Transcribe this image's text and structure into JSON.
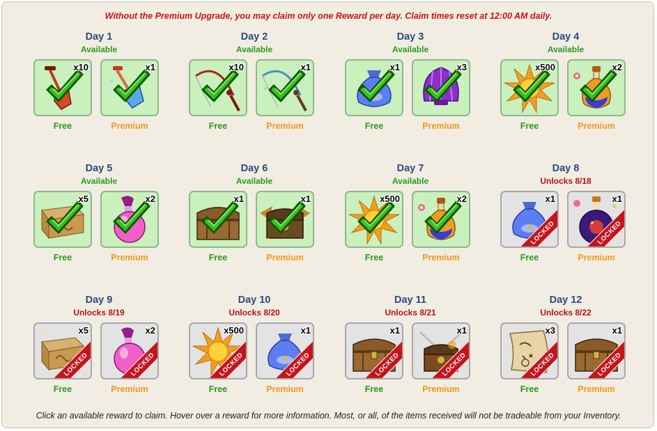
{
  "notice": "Without the Premium Upgrade, you may claim only one Reward per day. Claim times reset at 12:00 AM daily.",
  "footer": "Click an available reward to claim. Hover over a reward for more information. Most, or all, of the items received will not be tradeable from your Inventory.",
  "labels": {
    "free": "Free",
    "premium": "Premium",
    "locked": "LOCKED"
  },
  "colors": {
    "available": "#2a9a1e",
    "locked": "#b31515",
    "title": "#2c4a7e",
    "premium": "#f09a1e"
  },
  "days": [
    {
      "title": "Day 1",
      "status": "Available",
      "state": "available",
      "free": {
        "qty": "x10",
        "icon": "shovel-red-icon"
      },
      "premium": {
        "qty": "x1",
        "icon": "shovel-blue-icon"
      }
    },
    {
      "title": "Day 2",
      "status": "Available",
      "state": "available",
      "free": {
        "qty": "x10",
        "icon": "fishing-rod-red-icon"
      },
      "premium": {
        "qty": "x1",
        "icon": "fishing-rod-blue-icon"
      }
    },
    {
      "title": "Day 3",
      "status": "Available",
      "state": "available",
      "free": {
        "qty": "x1",
        "icon": "coin-sack-icon"
      },
      "premium": {
        "qty": "x3",
        "icon": "purple-shell-icon"
      }
    },
    {
      "title": "Day 4",
      "status": "Available",
      "state": "available",
      "free": {
        "qty": "x500",
        "icon": "sun-icon"
      },
      "premium": {
        "qty": "x2",
        "icon": "potion-flask-icon"
      }
    },
    {
      "title": "Day 5",
      "status": "Available",
      "state": "available",
      "free": {
        "qty": "x5",
        "icon": "wooden-box-icon"
      },
      "premium": {
        "qty": "x2",
        "icon": "pink-potion-icon"
      }
    },
    {
      "title": "Day 6",
      "status": "Available",
      "state": "available",
      "free": {
        "qty": "x1",
        "icon": "treasure-chest-icon"
      },
      "premium": {
        "qty": "x1",
        "icon": "winged-chest-icon"
      }
    },
    {
      "title": "Day 7",
      "status": "Available",
      "state": "available",
      "free": {
        "qty": "x500",
        "icon": "sun-icon"
      },
      "premium": {
        "qty": "x2",
        "icon": "potion-flask-icon"
      }
    },
    {
      "title": "Day 8",
      "status": "Unlocks 8/18",
      "state": "locked",
      "free": {
        "qty": "x1",
        "icon": "coin-sack-icon"
      },
      "premium": {
        "qty": "x1",
        "icon": "cosmic-potion-icon"
      }
    },
    {
      "title": "Day 9",
      "status": "Unlocks 8/19",
      "state": "locked",
      "free": {
        "qty": "x5",
        "icon": "wooden-box-icon"
      },
      "premium": {
        "qty": "x2",
        "icon": "pink-potion-icon"
      }
    },
    {
      "title": "Day 10",
      "status": "Unlocks 8/20",
      "state": "locked",
      "free": {
        "qty": "x500",
        "icon": "sun-icon"
      },
      "premium": {
        "qty": "x1",
        "icon": "coin-sack-icon"
      }
    },
    {
      "title": "Day 11",
      "status": "Unlocks 8/21",
      "state": "locked",
      "free": {
        "qty": "x1",
        "icon": "treasure-chest-icon"
      },
      "premium": {
        "qty": "x1",
        "icon": "sword-chest-icon"
      }
    },
    {
      "title": "Day 12",
      "status": "Unlocks 8/22",
      "state": "locked",
      "free": {
        "qty": "x3",
        "icon": "treasure-map-icon"
      },
      "premium": {
        "qty": "x1",
        "icon": "treasure-chest-icon"
      }
    }
  ]
}
